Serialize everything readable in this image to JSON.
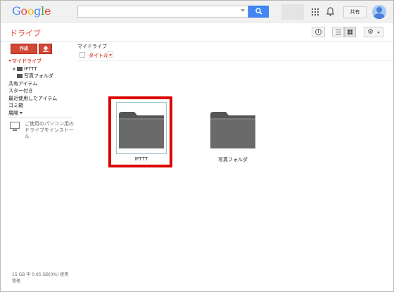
{
  "header": {
    "logo": [
      {
        "ch": "G",
        "color": "#4285f4"
      },
      {
        "ch": "o",
        "color": "#ea4335"
      },
      {
        "ch": "o",
        "color": "#fbbc05"
      },
      {
        "ch": "g",
        "color": "#4285f4"
      },
      {
        "ch": "l",
        "color": "#34a853"
      },
      {
        "ch": "e",
        "color": "#ea4335"
      }
    ],
    "search_value": "",
    "share_label": "共有"
  },
  "app_title": "ドライブ",
  "toolbar": {
    "create_label": "作成",
    "settings_glyph": "⚙"
  },
  "sidebar": {
    "my_drive": "マイドライブ",
    "folders": [
      "IFTTT",
      "写真フォルダ"
    ],
    "items": [
      "共有アイテム",
      "スター付き",
      "最近使用したアイテム",
      "ゴミ箱",
      "展開"
    ],
    "install_text": "ご使用のパソコン用のドライブをインストール",
    "storage_text": "15 GB 中 0.05 GB(0%) 使用",
    "manage_label": "管理"
  },
  "main": {
    "breadcrumb": "マイドライブ",
    "column_title": "タイトル",
    "tiles": [
      {
        "name": "IFTTT",
        "selected": true
      },
      {
        "name": "写真フォルダ",
        "selected": false
      }
    ]
  },
  "colors": {
    "accent_red": "#dd4b39",
    "search_blue": "#4285f4",
    "highlight_red": "#dd0000",
    "folder_gray": "#666666"
  }
}
